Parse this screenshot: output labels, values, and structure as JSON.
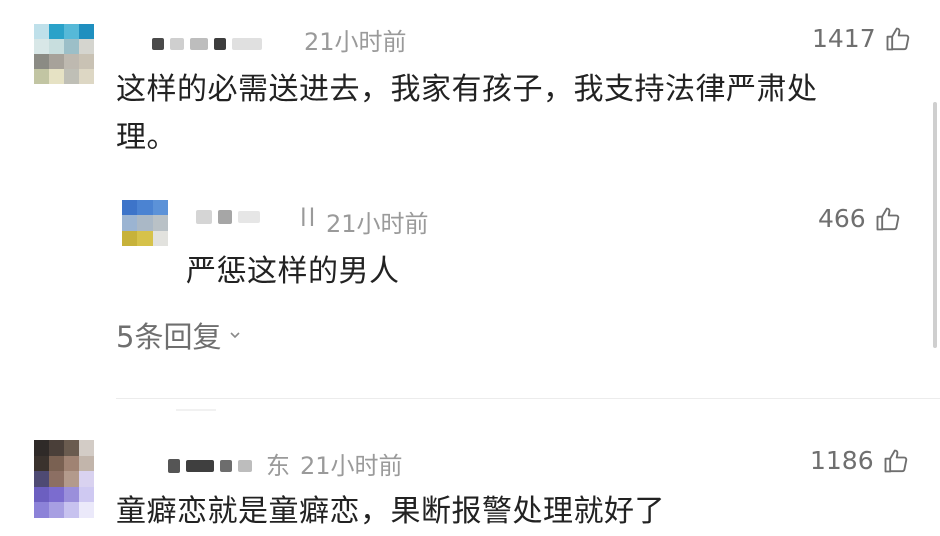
{
  "comments": [
    {
      "time": "21小时前",
      "likes": "1417",
      "text_line1": "这样的必需送进去，我家有孩子，我支持法律严肃处",
      "text_line2": "理。"
    },
    {
      "reply_prefix": "ll",
      "time": "21小时前",
      "likes": "466",
      "text": "严惩这样的男人"
    },
    {
      "location": "东",
      "time": "21小时前",
      "likes": "1186",
      "text": "童癖恋就是童癖恋，果断报警处理就好了"
    }
  ],
  "replies_link": {
    "label": "5条回复"
  },
  "icons": {
    "like": "thumbs-up-icon",
    "expand": "chevron-down-icon"
  },
  "colors": {
    "text": "#222222",
    "meta": "#9a9a9a",
    "counts": "#6f6f6f",
    "divider": "#ececec"
  }
}
